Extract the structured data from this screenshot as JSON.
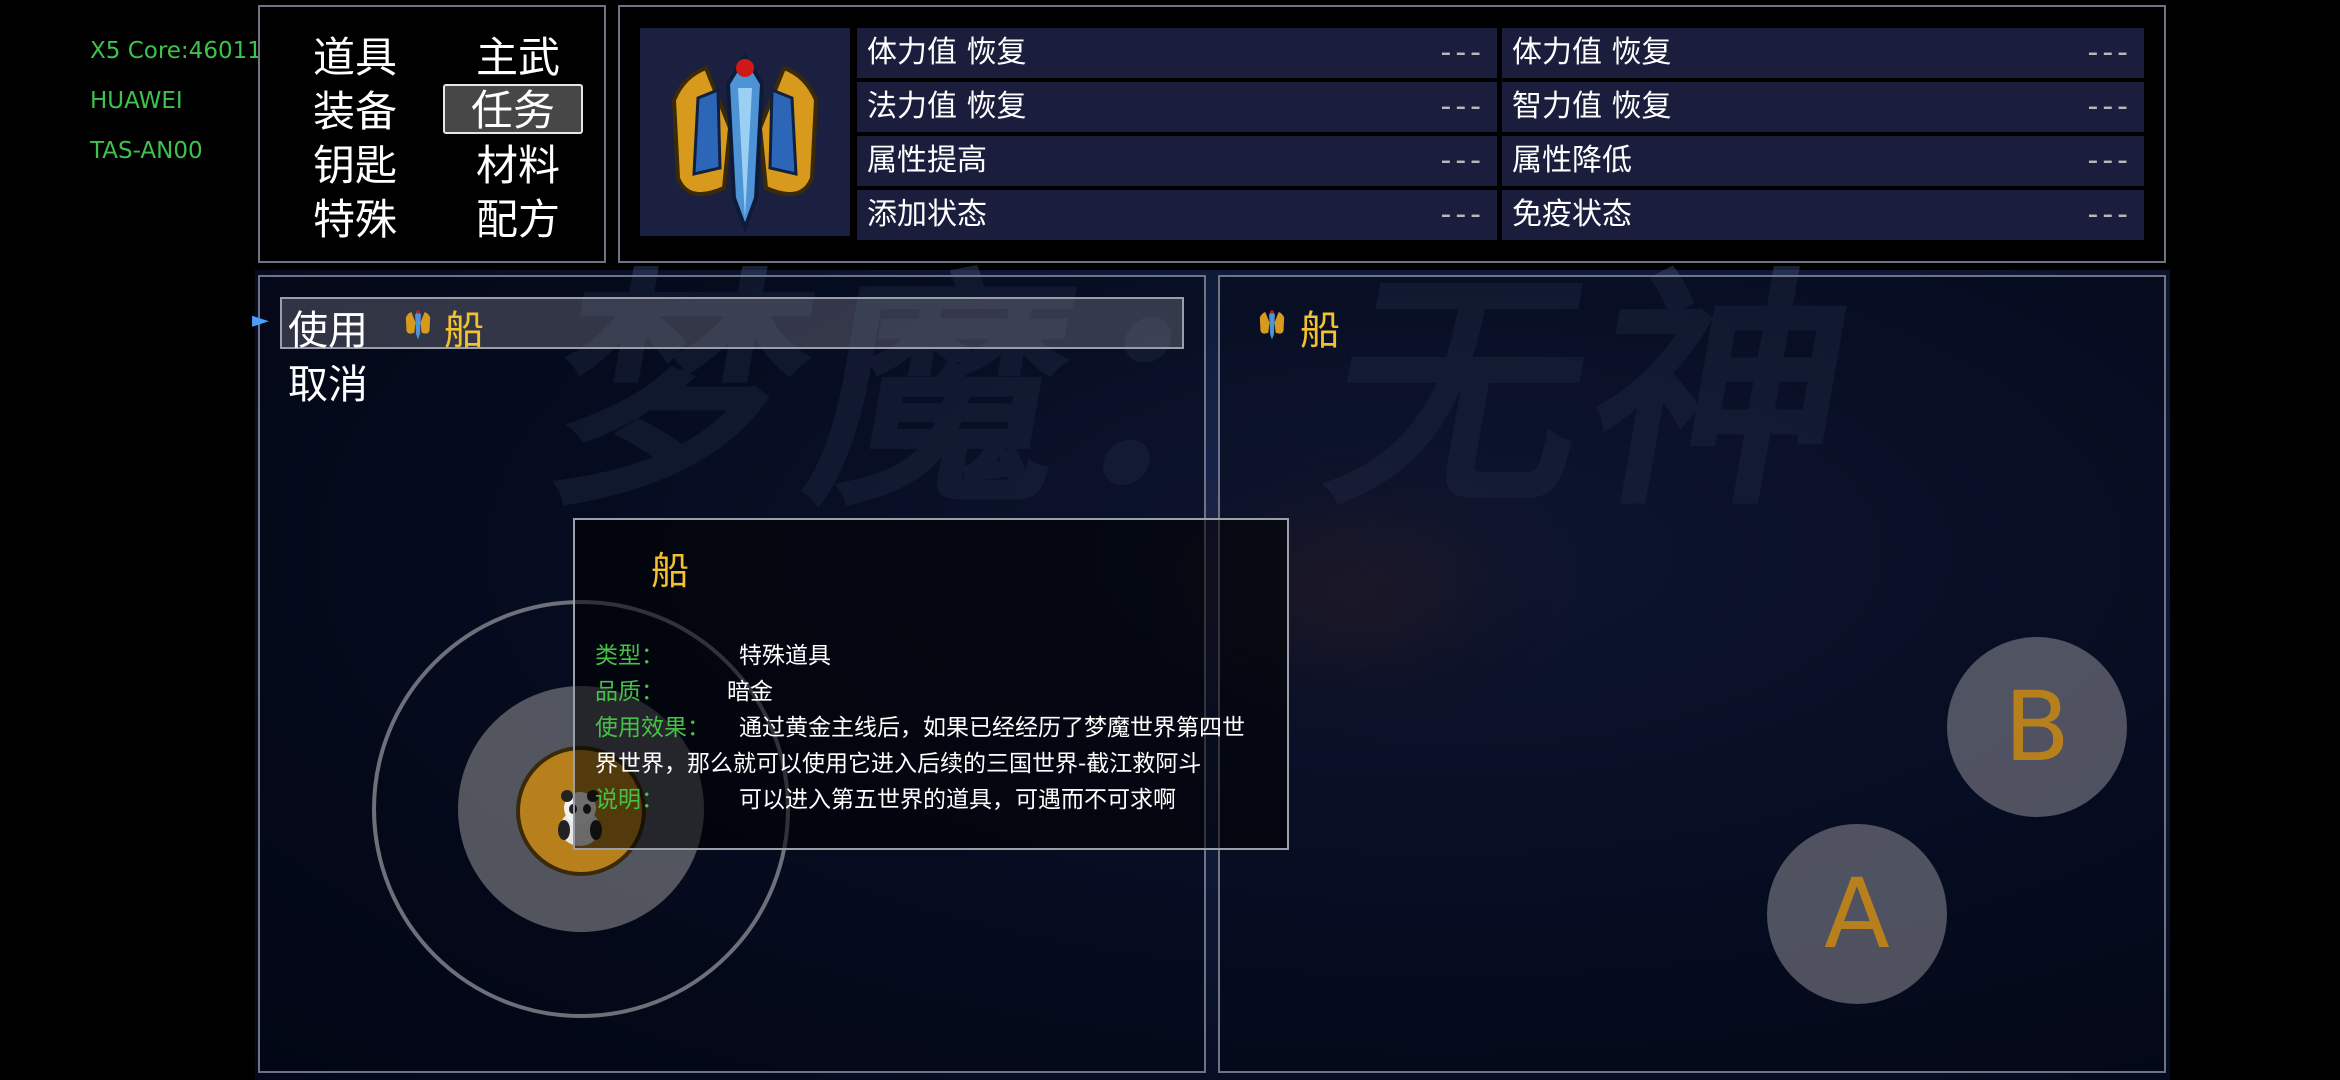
{
  "sysinfo": {
    "line1": "X5 Core:46011",
    "line2": "HUAWEI",
    "line3": "TAS-AN00"
  },
  "watermark": "梦魔：无神",
  "categories": [
    "道具",
    "主武",
    "装备",
    "任务",
    "钥匙",
    "材料",
    "特殊",
    "配方"
  ],
  "selected_category": "任务",
  "stats": [
    {
      "label": "体力值 恢复",
      "value": "---"
    },
    {
      "label": "体力值 恢复",
      "value": "---"
    },
    {
      "label": "法力值 恢复",
      "value": "---"
    },
    {
      "label": "智力值 恢复",
      "value": "---"
    },
    {
      "label": "属性提高",
      "value": "---"
    },
    {
      "label": "属性降低",
      "value": "---"
    },
    {
      "label": "添加状态",
      "value": "---"
    },
    {
      "label": "免疫状态",
      "value": "---"
    }
  ],
  "commands": {
    "use": "使用",
    "cancel": "取消"
  },
  "item": {
    "name": "船"
  },
  "tooltip": {
    "title": "船",
    "type_label": "类型：",
    "type_value": "特殊道具",
    "quality_label": "品质：",
    "quality_value": "暗金",
    "effect_label": "使用效果：",
    "effect_line1": "通过黄金主线后，如果已经经历了梦魔世界第四世",
    "effect_line2": "界世界，那么就可以使用它进入后续的三国世界-截江救阿斗",
    "desc_label": "说明：",
    "desc_value": "可以进入第五世界的道具，可遇而不可求啊"
  },
  "buttons": {
    "a": "A",
    "b": "B"
  },
  "colors": {
    "highlight_text": "#f2c030",
    "tooltip_label": "#46c146",
    "sysinfo": "#3ec24e",
    "button_letter": "#b8801c"
  }
}
